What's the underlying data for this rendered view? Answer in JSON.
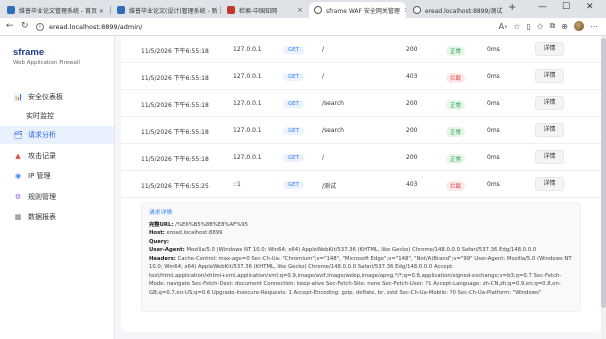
{
  "browser": {
    "tabs": [
      {
        "title": "维普毕业论文管理系统 - 首页 ×",
        "fav_color": "#2f6fb5"
      },
      {
        "title": "维普毕业论文(设计)管理系统 - 新",
        "fav_color": "#2f6fb5"
      },
      {
        "title": "检索-中国知网",
        "fav_color": "#c0392b"
      },
      {
        "title": "sframe WAF 安全网关管理",
        "fav_color": "#555555"
      },
      {
        "title": "eread.localhost:8899/测试",
        "fav_color": "#555555"
      }
    ],
    "url": "eread.localhost:8899/admin/"
  },
  "sidebar": {
    "brand": "sframe",
    "subtitle": "Web Application Firewall",
    "items": [
      {
        "label": "安全仪表板",
        "icon": "📊",
        "icon_name": "dashboard-icon"
      },
      {
        "label": "实时监控",
        "icon": "",
        "icon_name": ""
      },
      {
        "label": "请求分析",
        "icon": "🗂",
        "icon_name": "analysis-icon"
      },
      {
        "label": "攻击记录",
        "icon": "▲",
        "icon_name": "attack-icon"
      },
      {
        "label": "IP 管理",
        "icon": "◉",
        "icon_name": "ip-icon"
      },
      {
        "label": "规则管理",
        "icon": "⚙",
        "icon_name": "rules-icon"
      },
      {
        "label": "数据报表",
        "icon": "▦",
        "icon_name": "report-icon"
      }
    ]
  },
  "table": {
    "rows": [
      {
        "time": "11/5/2026 下午6:55:18",
        "ip": "127.0.0.1",
        "method": "GET",
        "path": "/",
        "code": "200",
        "status": "正常",
        "status_type": "ok",
        "duration": "0ms",
        "action": "详情"
      },
      {
        "time": "11/5/2026 下午6:55:18",
        "ip": "127.0.0.1",
        "method": "GET",
        "path": "/",
        "code": "403",
        "status": "拦截",
        "status_type": "block",
        "duration": "0ms",
        "action": "详情"
      },
      {
        "time": "11/5/2026 下午6:55:18",
        "ip": "127.0.0.1",
        "method": "GET",
        "path": "/search",
        "code": "200",
        "status": "正常",
        "status_type": "ok",
        "duration": "0ms",
        "action": "详情"
      },
      {
        "time": "11/5/2026 下午6:55:18",
        "ip": "127.0.0.1",
        "method": "GET",
        "path": "/search",
        "code": "200",
        "status": "正常",
        "status_type": "ok",
        "duration": "0ms",
        "action": "详情"
      },
      {
        "time": "11/5/2026 下午6:55:18",
        "ip": "127.0.0.1",
        "method": "GET",
        "path": "/",
        "code": "200",
        "status": "正常",
        "status_type": "ok",
        "duration": "0ms",
        "action": "详情"
      },
      {
        "time": "11/5/2026 下午6:55:25",
        "ip": "::1",
        "method": "GET",
        "path": "/测试",
        "code": "403",
        "status": "拦截",
        "status_type": "block",
        "duration": "0ms",
        "action": "详情"
      }
    ]
  },
  "detail": {
    "title": "请求详情",
    "full_url_label": "完整URL:",
    "full_url": "/%E6%B5%8B%E8%AF%95",
    "host_label": "Host:",
    "host": "eread.localhost:8899",
    "query_label": "Query:",
    "query": "",
    "ua_label": "User-Agent:",
    "ua": "Mozilla/5.0 (Windows NT 10.0; Win64; x64) AppleWebKit/537.36 (KHTML, like Gecko) Chrome/148.0.0.0 Safari/537.36 Edg/148.0.0.0",
    "headers_label": "Headers:",
    "headers": "Cache-Control: max-age=0 Sec-Ch-Ua: \"Chromium\";v=\"148\", \"Microsoft Edge\";v=\"148\", \"Not/A)Brand\";v=\"99\" User-Agent: Mozilla/5.0 (Windows NT 10.0; Win64; x64) AppleWebKit/537.36 (KHTML, like Gecko) Chrome/148.0.0.0 Safari/537.36 Edg/148.0.0.0 Accept: text/html,application/xhtml+xml,application/xml;q=0.9,image/avif,image/webp,image/apng,*/*;q=0.8,application/signed-exchange;v=b3;q=0.7 Sec-Fetch-Mode: navigate Sec-Fetch-Dest: document Connection: keep-alive Sec-Fetch-Site: none Sec-Fetch-User: ?1 Accept-Language: zh-CN,zh;q=0.9,en;q=0.8,en-GB;q=0.7,en-US;q=0.6 Upgrade-Insecure-Requests: 1 Accept-Encoding: gzip, deflate, br, zstd Sec-Ch-Ua-Mobile: ?0 Sec-Ch-Ua-Platform: \"Windows\""
  }
}
